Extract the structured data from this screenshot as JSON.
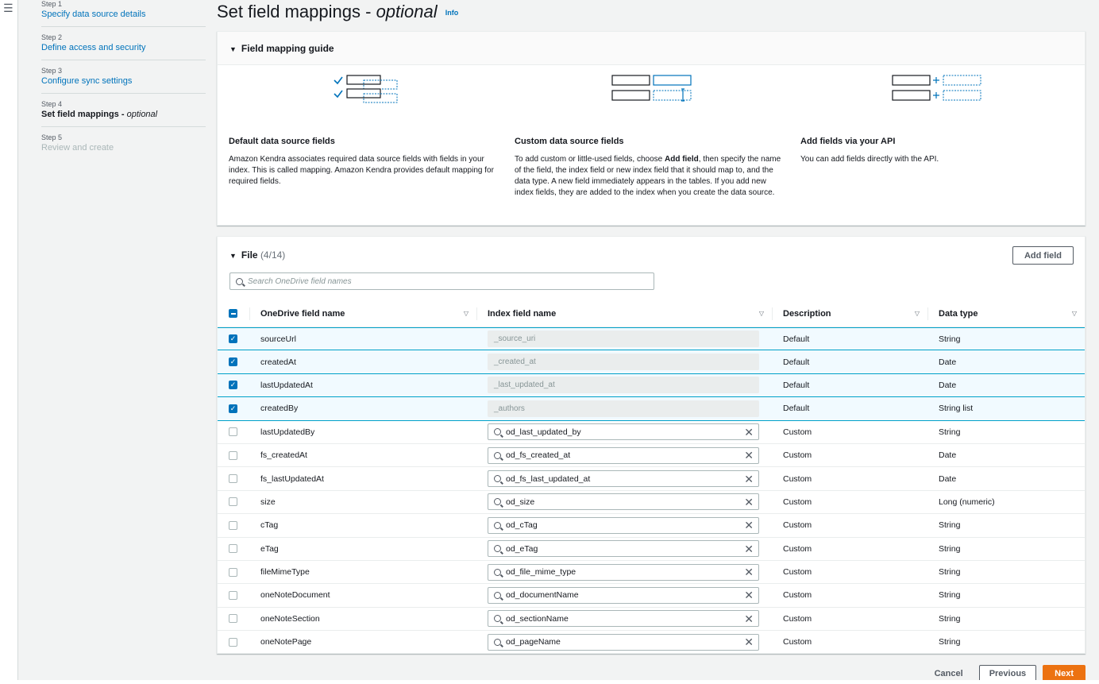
{
  "nav": {
    "steps": [
      {
        "num": "Step 1",
        "label": "Specify data source details",
        "state": "link"
      },
      {
        "num": "Step 2",
        "label": "Define access and security",
        "state": "link"
      },
      {
        "num": "Step 3",
        "label": "Configure sync settings",
        "state": "link"
      },
      {
        "num": "Step 4",
        "label": "Set field mappings",
        "label_suffix": "optional",
        "state": "current"
      },
      {
        "num": "Step 5",
        "label": "Review and create",
        "state": "disabled"
      }
    ]
  },
  "page": {
    "title": "Set field mappings -",
    "title_suffix": "optional",
    "info_label": "Info"
  },
  "guide": {
    "heading": "Field mapping guide",
    "columns": [
      {
        "heading": "Default data source fields",
        "text": "Amazon Kendra associates required data source fields with fields in your index. This is called mapping. Amazon Kendra provides default mapping for required fields."
      },
      {
        "heading": "Custom data source fields",
        "text_before": "To add custom or little-used fields, choose ",
        "text_bold": "Add field",
        "text_after": ", then specify the name of the field, the index field or new index field that it should map to, and the data type. A new field immediately appears in the tables. If you add new index fields, they are added to the index when you create the data source."
      },
      {
        "heading": "Add fields via your API",
        "text": "You can add fields directly with the API."
      }
    ]
  },
  "file_table": {
    "heading": "File",
    "count": "(4/14)",
    "add_field_label": "Add field",
    "search_placeholder": "Search OneDrive field names",
    "columns": [
      "OneDrive field name",
      "Index field name",
      "Description",
      "Data type"
    ],
    "rows": [
      {
        "name": "sourceUrl",
        "index": "_source_uri",
        "desc": "Default",
        "type": "String",
        "checked": true,
        "editable": false
      },
      {
        "name": "createdAt",
        "index": "_created_at",
        "desc": "Default",
        "type": "Date",
        "checked": true,
        "editable": false
      },
      {
        "name": "lastUpdatedAt",
        "index": "_last_updated_at",
        "desc": "Default",
        "type": "Date",
        "checked": true,
        "editable": false
      },
      {
        "name": "createdBy",
        "index": "_authors",
        "desc": "Default",
        "type": "String list",
        "checked": true,
        "editable": false
      },
      {
        "name": "lastUpdatedBy",
        "index": "od_last_updated_by",
        "desc": "Custom",
        "type": "String",
        "checked": false,
        "editable": true
      },
      {
        "name": "fs_createdAt",
        "index": "od_fs_created_at",
        "desc": "Custom",
        "type": "Date",
        "checked": false,
        "editable": true
      },
      {
        "name": "fs_lastUpdatedAt",
        "index": "od_fs_last_updated_at",
        "desc": "Custom",
        "type": "Date",
        "checked": false,
        "editable": true
      },
      {
        "name": "size",
        "index": "od_size",
        "desc": "Custom",
        "type": "Long (numeric)",
        "checked": false,
        "editable": true
      },
      {
        "name": "cTag",
        "index": "od_cTag",
        "desc": "Custom",
        "type": "String",
        "checked": false,
        "editable": true
      },
      {
        "name": "eTag",
        "index": "od_eTag",
        "desc": "Custom",
        "type": "String",
        "checked": false,
        "editable": true
      },
      {
        "name": "fileMimeType",
        "index": "od_file_mime_type",
        "desc": "Custom",
        "type": "String",
        "checked": false,
        "editable": true
      },
      {
        "name": "oneNoteDocument",
        "index": "od_documentName",
        "desc": "Custom",
        "type": "String",
        "checked": false,
        "editable": true
      },
      {
        "name": "oneNoteSection",
        "index": "od_sectionName",
        "desc": "Custom",
        "type": "String",
        "checked": false,
        "editable": true
      },
      {
        "name": "oneNotePage",
        "index": "od_pageName",
        "desc": "Custom",
        "type": "String",
        "checked": false,
        "editable": true
      }
    ]
  },
  "footer": {
    "cancel_label": "Cancel",
    "previous_label": "Previous",
    "next_label": "Next"
  },
  "icons": {
    "menu": "hamburger-icon",
    "caret": "caret-down-icon",
    "search": "search-icon",
    "sort": "sort-icon",
    "clear": "close-icon",
    "checkbox": "checkbox-icon"
  },
  "colors": {
    "link": "#0073bb",
    "primary": "#ec7211",
    "selected_row_bg": "#f1faff",
    "selected_row_border": "#00a1c9"
  }
}
